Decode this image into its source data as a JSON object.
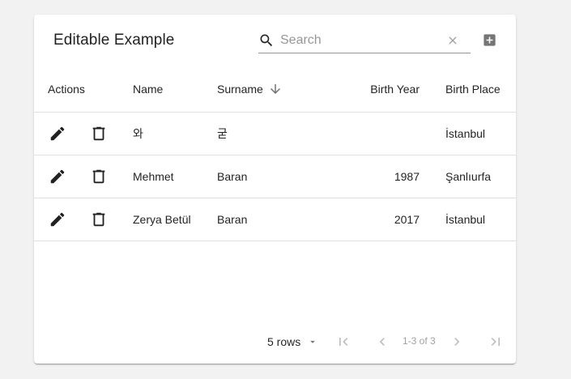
{
  "table": {
    "title": "Editable Example",
    "search": {
      "placeholder": "Search",
      "value": ""
    },
    "icons": {
      "search": "search-icon",
      "clear": "close-icon",
      "add": "add-box-icon",
      "edit": "pencil-icon",
      "delete": "trash-icon",
      "sort": "arrow-down-icon"
    },
    "columns": [
      "Actions",
      "Name",
      "Surname",
      "Birth Year",
      "Birth Place"
    ],
    "rows": [
      {
        "name": "와",
        "surname": "굳",
        "birth_year": "",
        "birth_place": "İstanbul"
      },
      {
        "name": "Mehmet",
        "surname": "Baran",
        "birth_year": "1987",
        "birth_place": "Şanlıurfa"
      },
      {
        "name": "Zerya Betül",
        "surname": "Baran",
        "birth_year": "2017",
        "birth_place": "İstanbul"
      }
    ],
    "pagination": {
      "rows_label": "5 rows",
      "info": "1-3 of 3"
    },
    "colors": {
      "icon": "#212121",
      "disabled": "#bdbdbd",
      "add_button": "#757575"
    }
  }
}
